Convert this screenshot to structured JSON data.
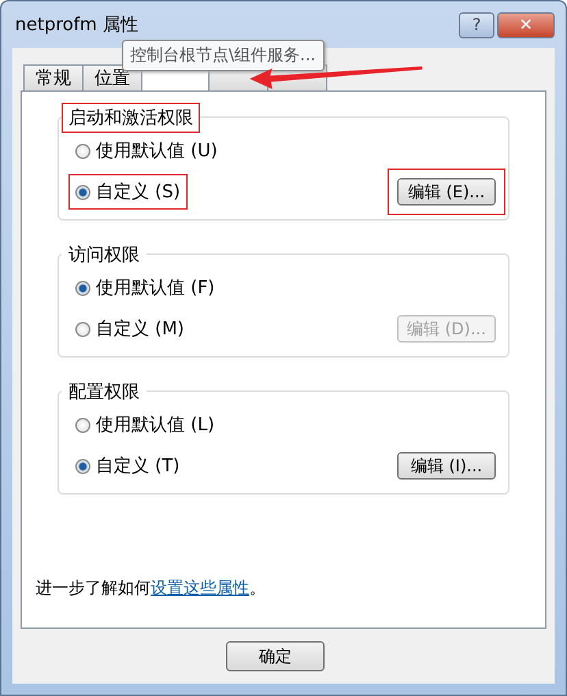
{
  "window": {
    "title": "netprofm 属性",
    "buttons": [
      {
        "kind": "help",
        "label": "?"
      },
      {
        "kind": "close",
        "label": "✕"
      }
    ]
  },
  "tabs": [
    {
      "label": "常规",
      "selected": false
    },
    {
      "label": "位置",
      "selected": false
    },
    {
      "selected": true
    },
    {
      "selected": false
    },
    {
      "selected": false
    }
  ],
  "tooltip": {
    "text": "控制台根节点\\组件服务...",
    "arrow": true
  },
  "groups": [
    {
      "title": "启动和激活权限",
      "highlighted": true,
      "options": [
        {
          "label": "使用默认值 (U)",
          "selected": false,
          "highlighted": false
        },
        {
          "label": "自定义 (S)",
          "selected": true,
          "highlighted": true
        }
      ],
      "button": {
        "label": "编辑 (E)...",
        "disabled": false,
        "highlighted": true
      }
    },
    {
      "title": "访问权限",
      "highlighted": false,
      "options": [
        {
          "label": "使用默认值 (F)",
          "selected": true,
          "highlighted": false
        },
        {
          "label": "自定义 (M)",
          "selected": false,
          "highlighted": false
        }
      ],
      "button": {
        "label": "编辑 (D)...",
        "disabled": true,
        "highlighted": false
      }
    },
    {
      "title": "配置权限",
      "highlighted": false,
      "options": [
        {
          "label": "使用默认值 (L)",
          "selected": false,
          "highlighted": false
        },
        {
          "label": "自定义 (T)",
          "selected": true,
          "highlighted": false
        }
      ],
      "button": {
        "label": "编辑 (I)...",
        "disabled": false,
        "highlighted": false
      }
    }
  ],
  "footer_text": {
    "before": "进一步了解如何",
    "link": "设置这些属性",
    "after": "。"
  },
  "buttons": [
    "确定"
  ]
}
